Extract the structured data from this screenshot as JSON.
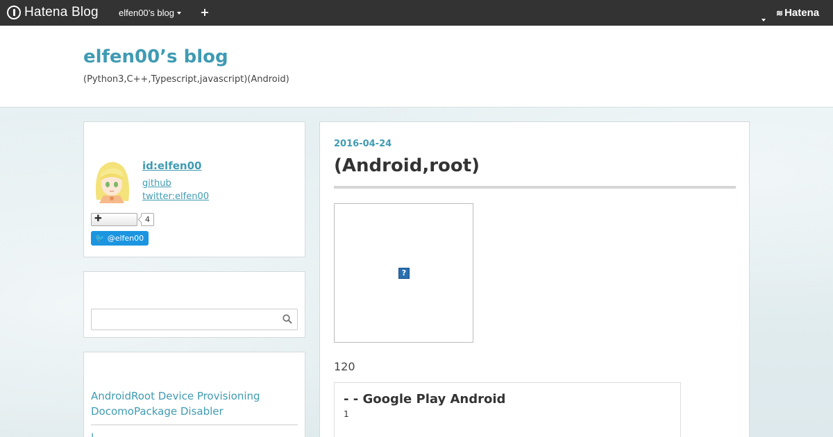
{
  "topbar": {
    "logo_text": "Hatena Blog",
    "blog_selector": "elfen00’s blog",
    "hatena_text": "Hatena"
  },
  "header": {
    "title": "elfen00’s blog",
    "description": "(Python3,C++,Typescript,javascript)(Android)"
  },
  "profile": {
    "id": "id:elfen00",
    "links": [
      "github",
      "twitter:elfen00"
    ],
    "star_count": "4",
    "twitter_button": "@elfen00"
  },
  "search": {
    "placeholder": ""
  },
  "recent_entries": {
    "item1": "AndroidRoot Device Provisioning DocomoPackage Disabler",
    "item2": "l"
  },
  "article": {
    "date": "2016-04-24",
    "title": "(Android,root)",
    "body_number": "120",
    "card_title": "- - Google Play  Android",
    "card_sub": "1"
  },
  "colors": {
    "accent": "#3f9bb3",
    "topbar": "#333333",
    "twitter": "#1b95e0"
  }
}
